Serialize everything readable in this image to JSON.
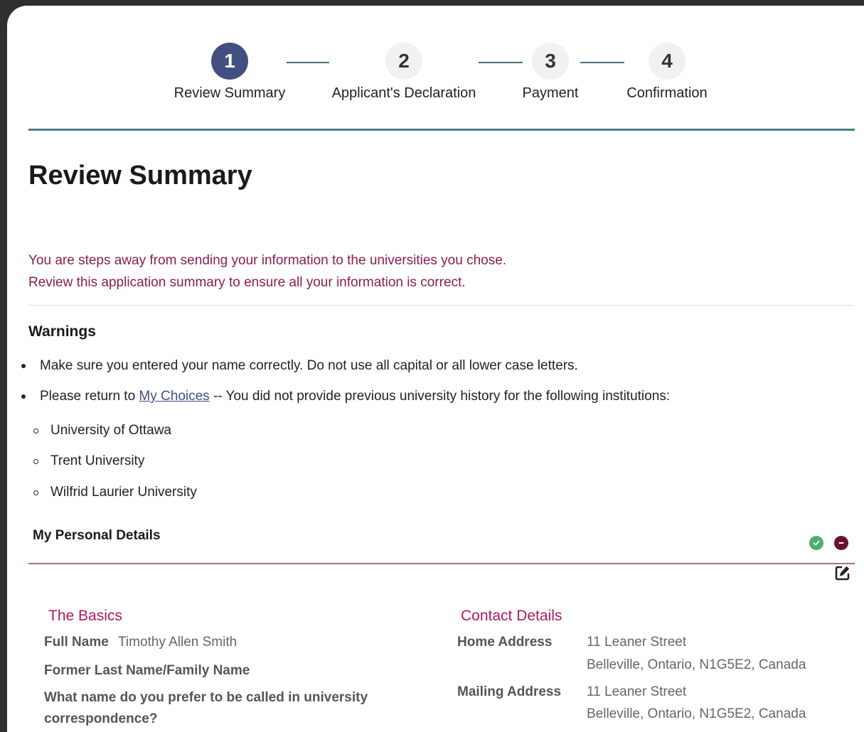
{
  "stepper": {
    "steps": [
      {
        "number": "1",
        "label": "Review Summary"
      },
      {
        "number": "2",
        "label": "Applicant's Declaration"
      },
      {
        "number": "3",
        "label": "Payment"
      },
      {
        "number": "4",
        "label": "Confirmation"
      }
    ],
    "active_step": 1
  },
  "page_title": "Review Summary",
  "intro": {
    "line1": "You are steps away from sending your information to the universities you chose.",
    "line2": "Review this application summary to ensure all your information is correct."
  },
  "warnings": {
    "title": "Warnings",
    "item1": "Make sure you entered your name correctly. Do not use all capital or all lower case letters.",
    "item2_prefix": "Please return to ",
    "item2_link": "My Choices",
    "item2_suffix": " -- You did not provide previous university history for the following institutions:",
    "institutions": [
      "University of Ottawa",
      "Trent University",
      "Wilfrid Laurier University"
    ]
  },
  "personal_details": {
    "title": "My Personal Details",
    "basics": {
      "title": "The Basics",
      "full_name_label": "Full Name",
      "full_name_value": "Timothy Allen Smith",
      "former_name_label": "Former Last Name/Family Name",
      "preferred_name_label_1": "What name do you prefer to be called in university",
      "preferred_name_label_2": "correspondence?"
    },
    "contact": {
      "title": "Contact Details",
      "home_label": "Home Address",
      "home_line1": "11 Leaner Street",
      "home_line2": "Belleville, Ontario, N1G5E2, Canada",
      "mailing_label": "Mailing Address",
      "mailing_line1": "11 Leaner Street",
      "mailing_line2": "Belleville, Ontario, N1G5E2, Canada"
    }
  },
  "colors": {
    "active_step": "#415080",
    "accent_plum": "#8a1e4e",
    "heading_magenta": "#b0195f",
    "teal_rule": "#4a7f85"
  },
  "icons": {
    "status_ok": "check-circle-icon",
    "status_remove": "minus-circle-icon",
    "edit": "edit-icon"
  }
}
